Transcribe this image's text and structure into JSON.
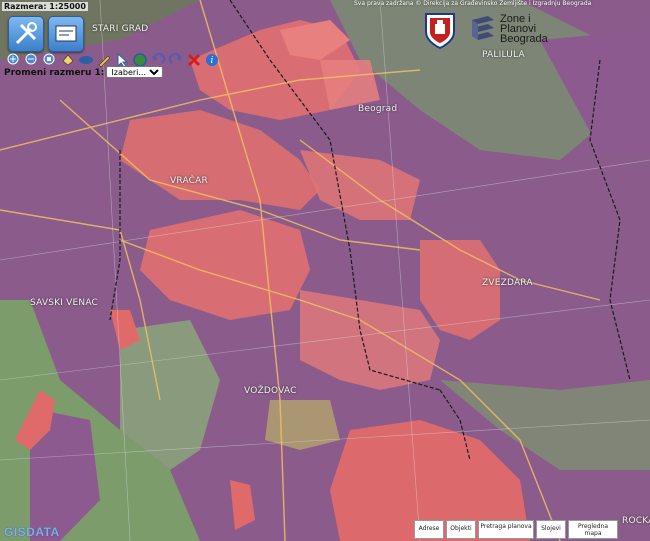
{
  "scale_label": "Razmera: 1:25000",
  "scale_control": {
    "label": "Promeni razmeru 1:",
    "selected": "Izaberi..."
  },
  "copyright": "Sva prava zadržana © Direkcija za Građevinsko Zemljište i Izgradnju Beograda",
  "logo": {
    "line1": "Zone i",
    "line2": "Planovi",
    "line3": "Beograda"
  },
  "brand": "GISDATA",
  "districts": {
    "stari_grad": "STARI GRAD",
    "vracar": "VRAČAR",
    "savski_venac": "SAVSKI VENAC",
    "zvezdara": "ZVEZDARA",
    "vozdovac": "VOŽDOVAC",
    "palilula": "PALILULA",
    "beograd": "Beograd",
    "rakovica": "ROCKA"
  },
  "tabs": [
    "Adrese",
    "Objekti",
    "Pretraga planova",
    "Slojevi",
    "Pregledna mapa"
  ],
  "toolbar": {
    "large_tools": [
      "tools-icon",
      "map-window-icon"
    ],
    "small_tools": [
      "zoom-in-icon",
      "zoom-out-icon",
      "zoom-extent-icon",
      "pan-icon",
      "measure-icon",
      "select-icon",
      "globe-icon",
      "undo-icon",
      "redo-icon",
      "clear-icon",
      "info-icon"
    ]
  },
  "colors": {
    "residential_zone": "#e07070",
    "mixed_zone": "#8d5a8f",
    "green_zone": "#7e9c6e",
    "brand_blue": "#7fb0e8"
  }
}
